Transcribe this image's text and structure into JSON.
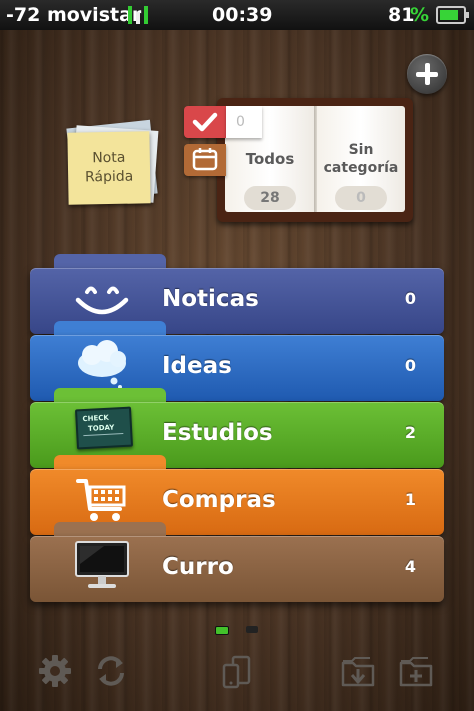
{
  "status_bar": {
    "carrier": "-72 movistar",
    "time": "00:39",
    "battery_text": "81",
    "battery_percent_symbol": "%",
    "battery_level": 0.81
  },
  "quick_note": {
    "line1": "Nota",
    "line2": "Rápida"
  },
  "calendar": {
    "check_tab_count": "0",
    "all": {
      "title": "Todos",
      "count": "28"
    },
    "uncategorized": {
      "title_line1": "Sin",
      "title_line2": "categoría",
      "count": "0"
    }
  },
  "folders": [
    {
      "name": "Noticas",
      "count": "0",
      "icon": "smile-icon",
      "color_top": "#5464a8",
      "color_bottom": "#374688"
    },
    {
      "name": "Ideas",
      "count": "0",
      "icon": "cloud-icon",
      "color_top": "#3f7fd4",
      "color_bottom": "#1f5ab0"
    },
    {
      "name": "Estudios",
      "count": "2",
      "icon": "chalkboard-icon",
      "color_top": "#6cc036",
      "color_bottom": "#4a9a1c"
    },
    {
      "name": "Compras",
      "count": "1",
      "icon": "cart-icon",
      "color_top": "#f08a2a",
      "color_bottom": "#d86a12"
    },
    {
      "name": "Curro",
      "count": "4",
      "icon": "monitor-icon",
      "color_top": "#9b7150",
      "color_bottom": "#7a5536"
    }
  ],
  "chalkboard": {
    "line1": "CHECK",
    "line2": "TODAY"
  },
  "page_indicator": {
    "active_color": "#43c12b",
    "inactive_color": "#222222"
  },
  "toolbar": {
    "settings_icon": "gear-icon",
    "sync_icon": "sync-icon",
    "device_icon": "devices-icon",
    "import_icon": "folder-download-icon",
    "new_folder_icon": "folder-add-icon"
  }
}
